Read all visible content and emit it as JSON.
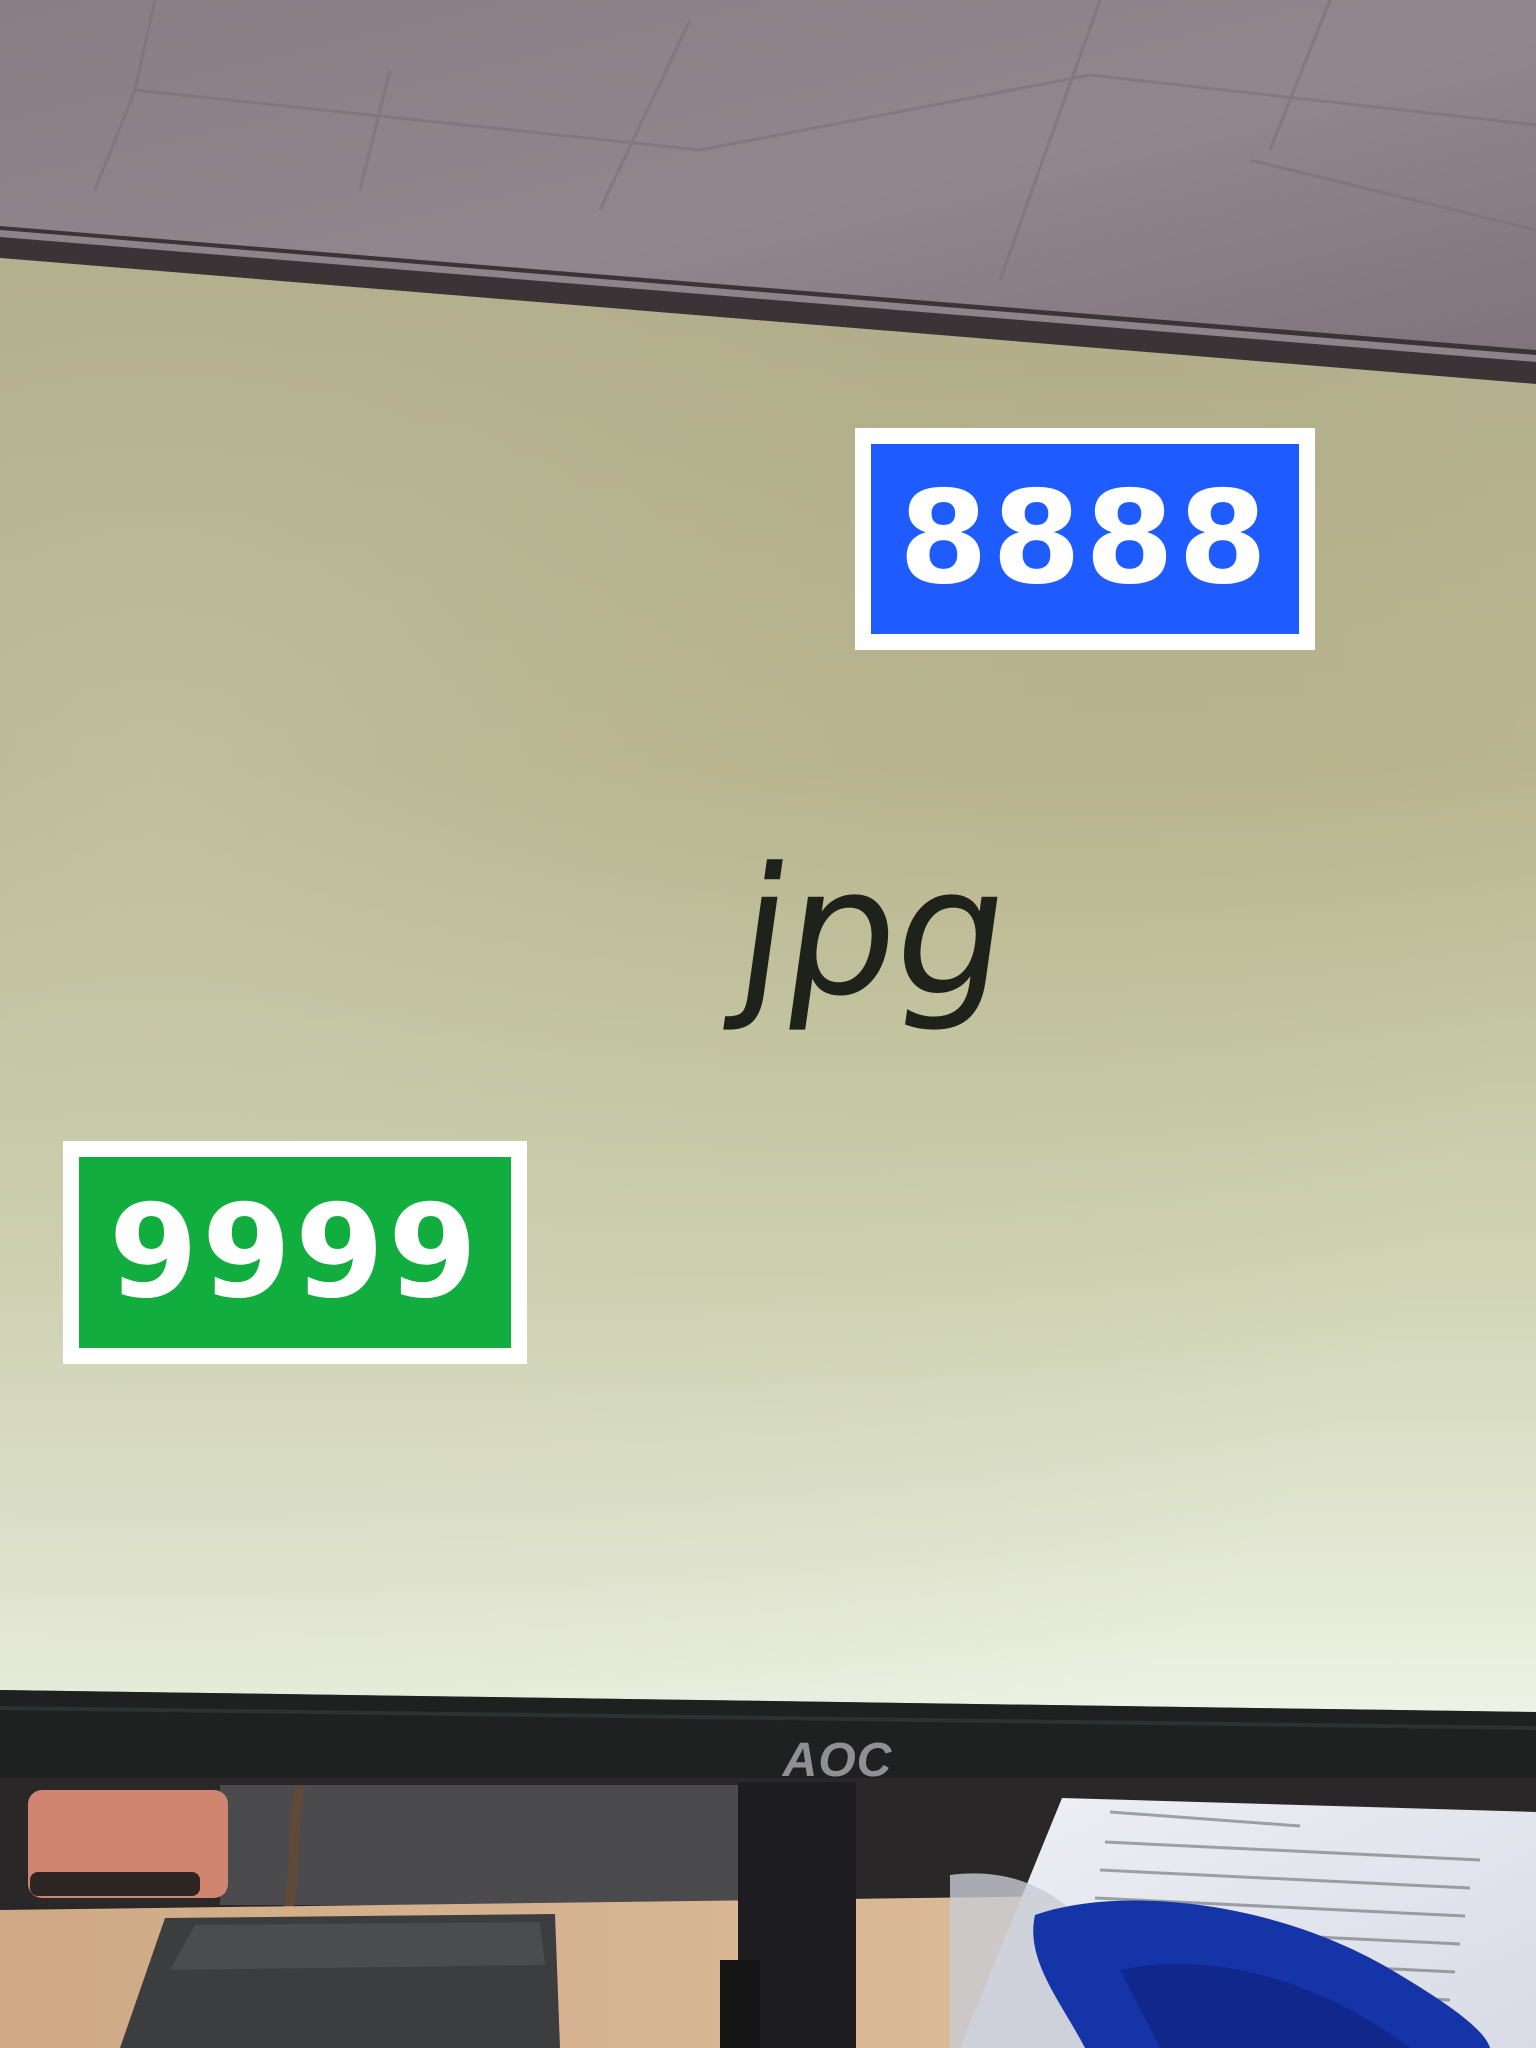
{
  "screen": {
    "text": "jpg"
  },
  "labels": {
    "top_right": {
      "text": "8888",
      "color": "#1f5cff"
    },
    "bottom_left": {
      "text": "9999",
      "color": "#11ad3e"
    }
  },
  "monitor": {
    "brand": "AOC"
  },
  "colors": {
    "ceiling": "#8d7c83",
    "screen_top": "#aeaa84",
    "screen_bottom": "#e6ecd8",
    "bezel": "#1f2121",
    "desk": "#d8b48e",
    "blue_cloth": "#1434a8"
  }
}
